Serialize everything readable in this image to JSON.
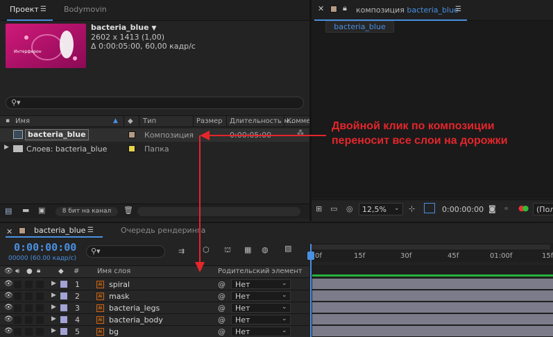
{
  "project": {
    "tabs": [
      "Проект",
      "Bodymovin"
    ],
    "thumbnail_text": "Интерферон",
    "comp_name": "bacteria_blue",
    "comp_size": "2602 x 1413 (1,00)",
    "comp_duration": "Δ 0:00:05:00, 60,00 кадр/с",
    "columns": [
      "Имя",
      "Тип",
      "Размер",
      "Длительность м...",
      "Комме"
    ],
    "items": [
      {
        "name": "bacteria_blue",
        "type": "Композиция",
        "duration": "0:00:05:00",
        "color": "#b59a84"
      },
      {
        "name": "Слоев: bacteria_blue",
        "type": "Папка",
        "duration": "",
        "color": "#e5d34a"
      }
    ],
    "bit_depth": "8 бит на канал"
  },
  "composition": {
    "panel_label": "композиция",
    "comp_name": "bacteria_blue",
    "tab_label": "bacteria_blue",
    "zoom": "12,5%",
    "timecode": "0:00:00:00",
    "view_label": "(Пол"
  },
  "annotation": {
    "line1": "Двойной клик по композиции",
    "line2": "переносит все слои на дорожки"
  },
  "timeline": {
    "tabs": [
      "bacteria_blue",
      "Очередь рендеринга"
    ],
    "timecode": "0:00:00:00",
    "frames": "00000 (60.00 кадр/с)",
    "col_num": "#",
    "col_name": "Имя слоя",
    "col_parent": "Родительский элемент ...",
    "ruler": [
      "0f",
      "15f",
      "30f",
      "45f",
      "01:00f",
      "15f"
    ],
    "layers": [
      {
        "num": "1",
        "name": "spiral",
        "parent": "Нет"
      },
      {
        "num": "2",
        "name": "mask",
        "parent": "Нет"
      },
      {
        "num": "3",
        "name": "bacteria_legs",
        "parent": "Нет"
      },
      {
        "num": "4",
        "name": "bacteria_body",
        "parent": "Нет"
      },
      {
        "num": "5",
        "name": "bg",
        "parent": "Нет"
      }
    ],
    "layer_color": "#a3a3d6"
  }
}
